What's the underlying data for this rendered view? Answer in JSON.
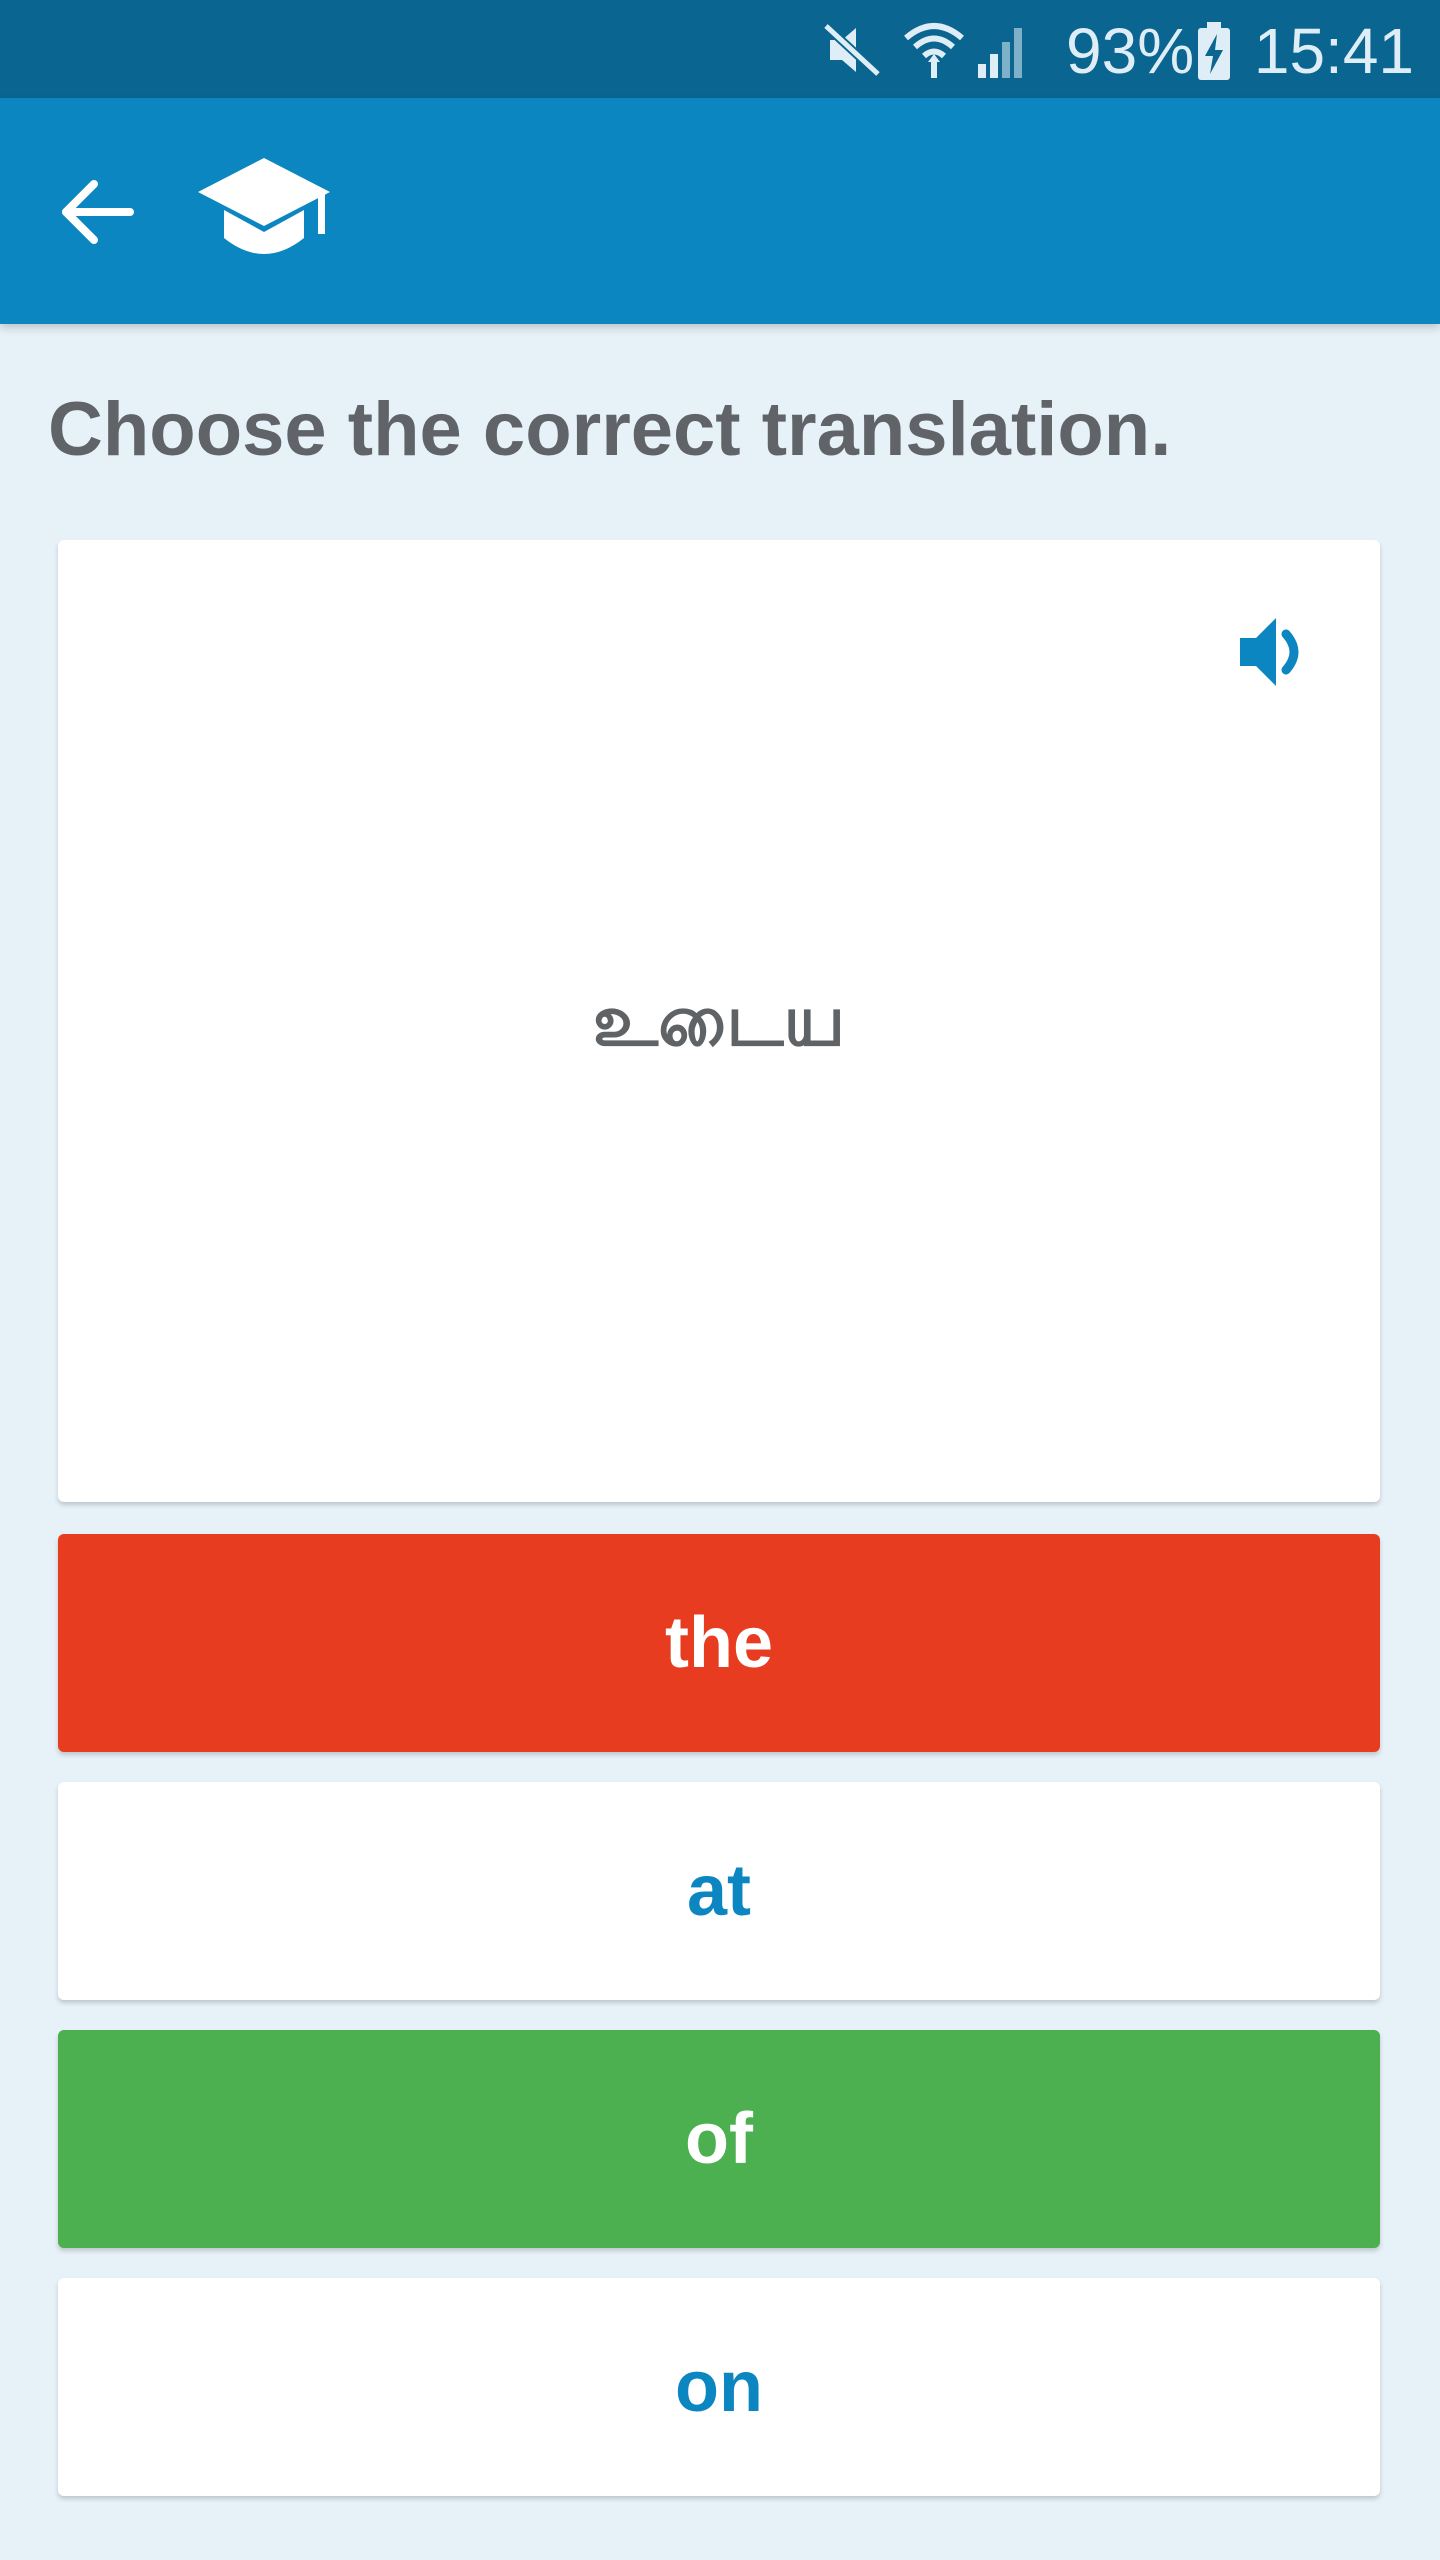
{
  "status_bar": {
    "battery_percent": "93%",
    "time": "15:41",
    "icons": [
      "mute-icon",
      "wifi-icon",
      "cell-signal-icon",
      "battery-charging-icon"
    ]
  },
  "app_bar": {
    "back_icon": "arrow-left-icon",
    "logo_icon": "graduation-cap-icon"
  },
  "exercise": {
    "instruction": "Choose the correct translation.",
    "prompt_word": "உடைய",
    "audio_icon": "speaker-icon",
    "answers": [
      {
        "label": "the",
        "state": "wrong",
        "color": "#e83c20"
      },
      {
        "label": "at",
        "state": "neutral",
        "color": "#ffffff"
      },
      {
        "label": "of",
        "state": "correct",
        "color": "#4caf50"
      },
      {
        "label": "on",
        "state": "neutral",
        "color": "#ffffff"
      }
    ]
  },
  "colors": {
    "status_bar": "#0a6590",
    "app_bar": "#0b86c0",
    "background": "#e7f2f8",
    "accent": "#0b86c0",
    "wrong": "#e83c20",
    "correct": "#4caf50"
  }
}
